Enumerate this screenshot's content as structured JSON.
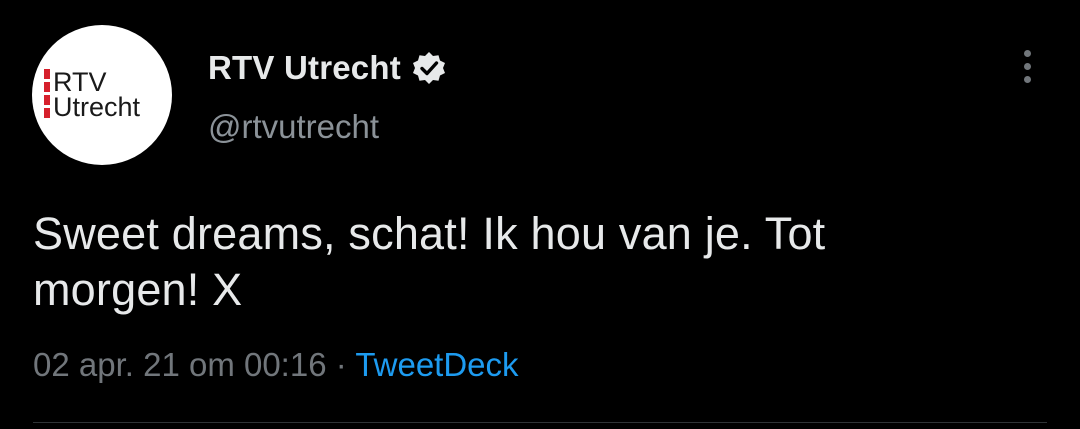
{
  "author": {
    "display_name": "RTV Utrecht",
    "handle": "@rtvutrecht",
    "verified": true,
    "avatar_logo_text": [
      "RTV",
      "Utrecht"
    ]
  },
  "tweet": {
    "text": "Sweet dreams, schat! Ik hou van je. Tot morgen! X",
    "timestamp": "02 apr. 21 om 00:16",
    "separator": "·",
    "source": "TweetDeck"
  },
  "icons": {
    "verified": "verified-badge-icon",
    "more": "more-options-icon"
  },
  "colors": {
    "background": "#000000",
    "primary_text": "#e7e9ea",
    "secondary_text": "#71767b",
    "link": "#1d9bf0",
    "logo_red": "#d6202c"
  }
}
